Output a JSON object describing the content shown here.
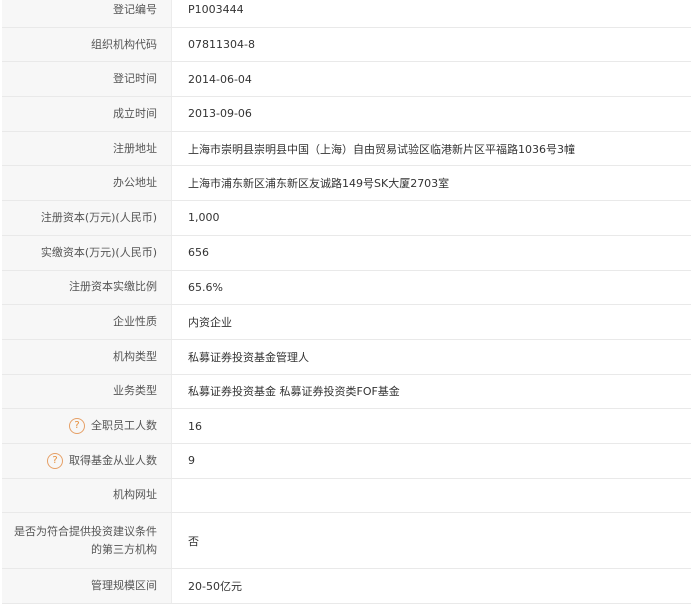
{
  "rows": [
    {
      "label": "登记编号",
      "value": "P1003444"
    },
    {
      "label": "组织机构代码",
      "value": "07811304-8"
    },
    {
      "label": "登记时间",
      "value": "2014-06-04"
    },
    {
      "label": "成立时间",
      "value": "2013-09-06"
    },
    {
      "label": "注册地址",
      "value": "上海市崇明县崇明县中国（上海）自由贸易试验区临港新片区平福路1036号3幢"
    },
    {
      "label": "办公地址",
      "value": "上海市浦东新区浦东新区友诚路149号SK大厦2703室"
    },
    {
      "label": "注册资本(万元)(人民币)",
      "value": "1,000"
    },
    {
      "label": "实缴资本(万元)(人民币)",
      "value": "656"
    },
    {
      "label": "注册资本实缴比例",
      "value": "65.6%"
    },
    {
      "label": "企业性质",
      "value": "内资企业"
    },
    {
      "label": "机构类型",
      "value": "私募证券投资基金管理人"
    },
    {
      "label": "业务类型",
      "value": "私募证券投资基金  私募证券投资类FOF基金"
    },
    {
      "label": "全职员工人数",
      "value": "16",
      "help": "?"
    },
    {
      "label": "取得基金从业人数",
      "value": "9",
      "help": "?"
    },
    {
      "label": "机构网址",
      "value": ""
    },
    {
      "label_line1": "是否为符合提供投资建议条件",
      "label_line2": "的第三方机构",
      "value": "否"
    },
    {
      "label": "管理规模区间",
      "value": "20-50亿元"
    }
  ]
}
